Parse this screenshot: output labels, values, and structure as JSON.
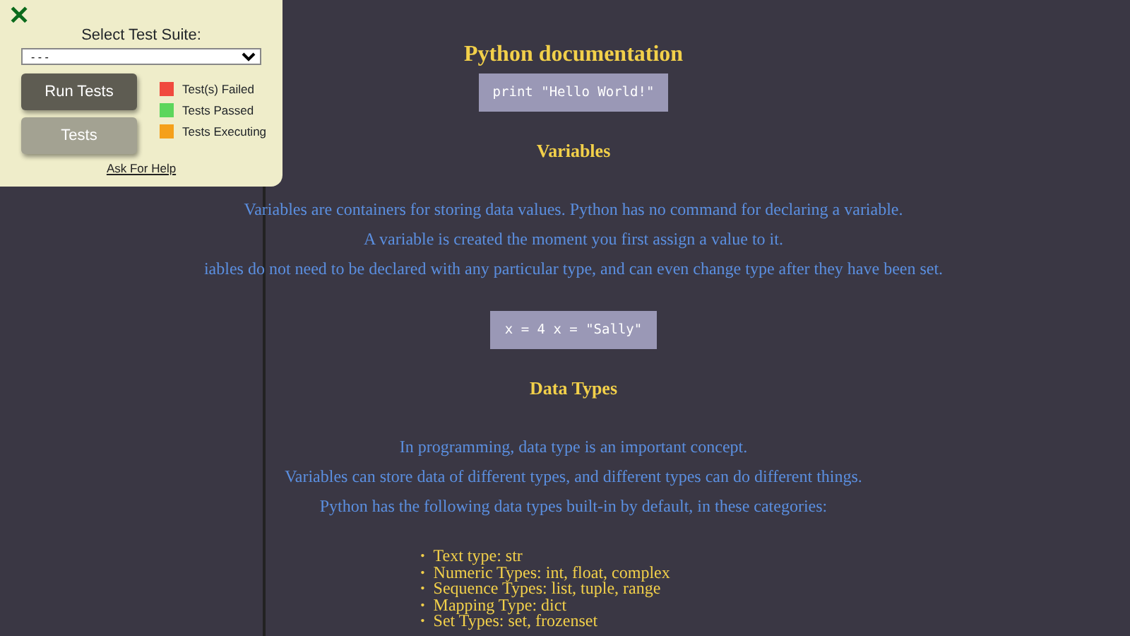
{
  "test_panel": {
    "close": "✕",
    "suite_label": "Select Test Suite:",
    "suite_value": "- - -",
    "buttons": [
      {
        "label": "Run Tests",
        "kind": "primary"
      },
      {
        "label": "Tests",
        "kind": "secondary"
      }
    ],
    "legend": [
      {
        "label": "Test(s) Failed",
        "color": "#f04a3e"
      },
      {
        "label": "Tests Passed",
        "color": "#5cd65c"
      },
      {
        "label": "Tests Executing",
        "color": "#f5a01a"
      }
    ],
    "help_link": "Ask For Help"
  },
  "content": [
    {
      "kind": "title",
      "text": "Python documentation"
    },
    {
      "kind": "code",
      "text": "print \"Hello World!\""
    },
    {
      "kind": "heading",
      "text": "Variables"
    },
    {
      "kind": "para",
      "text": "Variables are containers for storing data values. Python has no command for declaring a variable."
    },
    {
      "kind": "para",
      "text": "A variable is created the moment you first assign a value to it."
    },
    {
      "kind": "para",
      "text": "iables do not need to be declared with any particular type, and can even change type after they have been set."
    },
    {
      "kind": "code",
      "text": "x = 4 x = \"Sally\""
    },
    {
      "kind": "heading",
      "text": "Data Types"
    },
    {
      "kind": "para",
      "text": "In programming, data type is an important concept."
    },
    {
      "kind": "para",
      "text": "Variables can store data of different types, and different types can do different things."
    },
    {
      "kind": "para",
      "text": "Python has the following data types built-in by default, in these categories:"
    },
    {
      "kind": "list",
      "marker": "•",
      "items": [
        "Text type: str",
        "Numeric Types: int, float, complex",
        "Sequence Types: list, tuple, range",
        "Mapping Type: dict",
        "Set Types: set, frozenset"
      ]
    }
  ]
}
